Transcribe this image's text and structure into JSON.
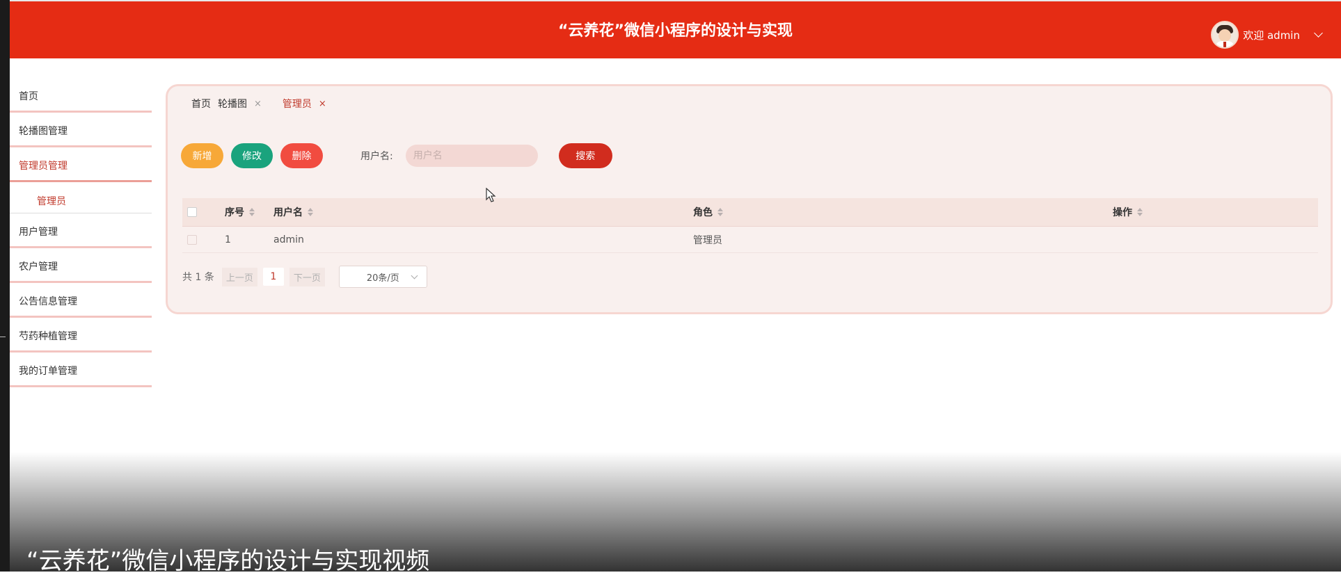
{
  "app": {
    "title": "“云养花”微信小程序的设计与实现"
  },
  "header": {
    "welcome_text": "欢迎 admin"
  },
  "sidebar": {
    "items": [
      {
        "label": "首页"
      },
      {
        "label": "轮播图管理"
      },
      {
        "label": "管理员管理",
        "active": true
      },
      {
        "label": "管理员",
        "sub": true
      },
      {
        "label": "用户管理"
      },
      {
        "label": "农户管理"
      },
      {
        "label": "公告信息管理"
      },
      {
        "label": "芍药种植管理"
      },
      {
        "label": "我的订单管理"
      }
    ]
  },
  "tabs": [
    {
      "label": "首页"
    },
    {
      "label": "轮播图",
      "close": "×"
    },
    {
      "label": "管理员",
      "close": "×",
      "active": true
    }
  ],
  "toolbar": {
    "add_label": "新增",
    "edit_label": "修改",
    "delete_label": "删除",
    "search_label": "用户名:",
    "search_placeholder": "用户名",
    "search_value": "",
    "search_button": "搜索"
  },
  "table": {
    "columns": [
      "序号",
      "用户名",
      "角色",
      "操作"
    ],
    "rows": [
      {
        "no": "1",
        "username": "admin",
        "role": "管理员",
        "action": ""
      }
    ]
  },
  "pagination": {
    "total": "共 1 条",
    "prev": "上一页",
    "current_page": "1",
    "next": "下一页",
    "page_size": "20条/页"
  },
  "video_caption": "“云养花”微信小程序的设计与实现视频",
  "colors": {
    "header_bg": "#e52c14",
    "accent": "#c0392b",
    "panel_bg": "#f9f0ee",
    "add_button": "#f7a838",
    "edit_button": "#1aa37d",
    "delete_button": "#f14c40",
    "search_button": "#d12c1e"
  }
}
